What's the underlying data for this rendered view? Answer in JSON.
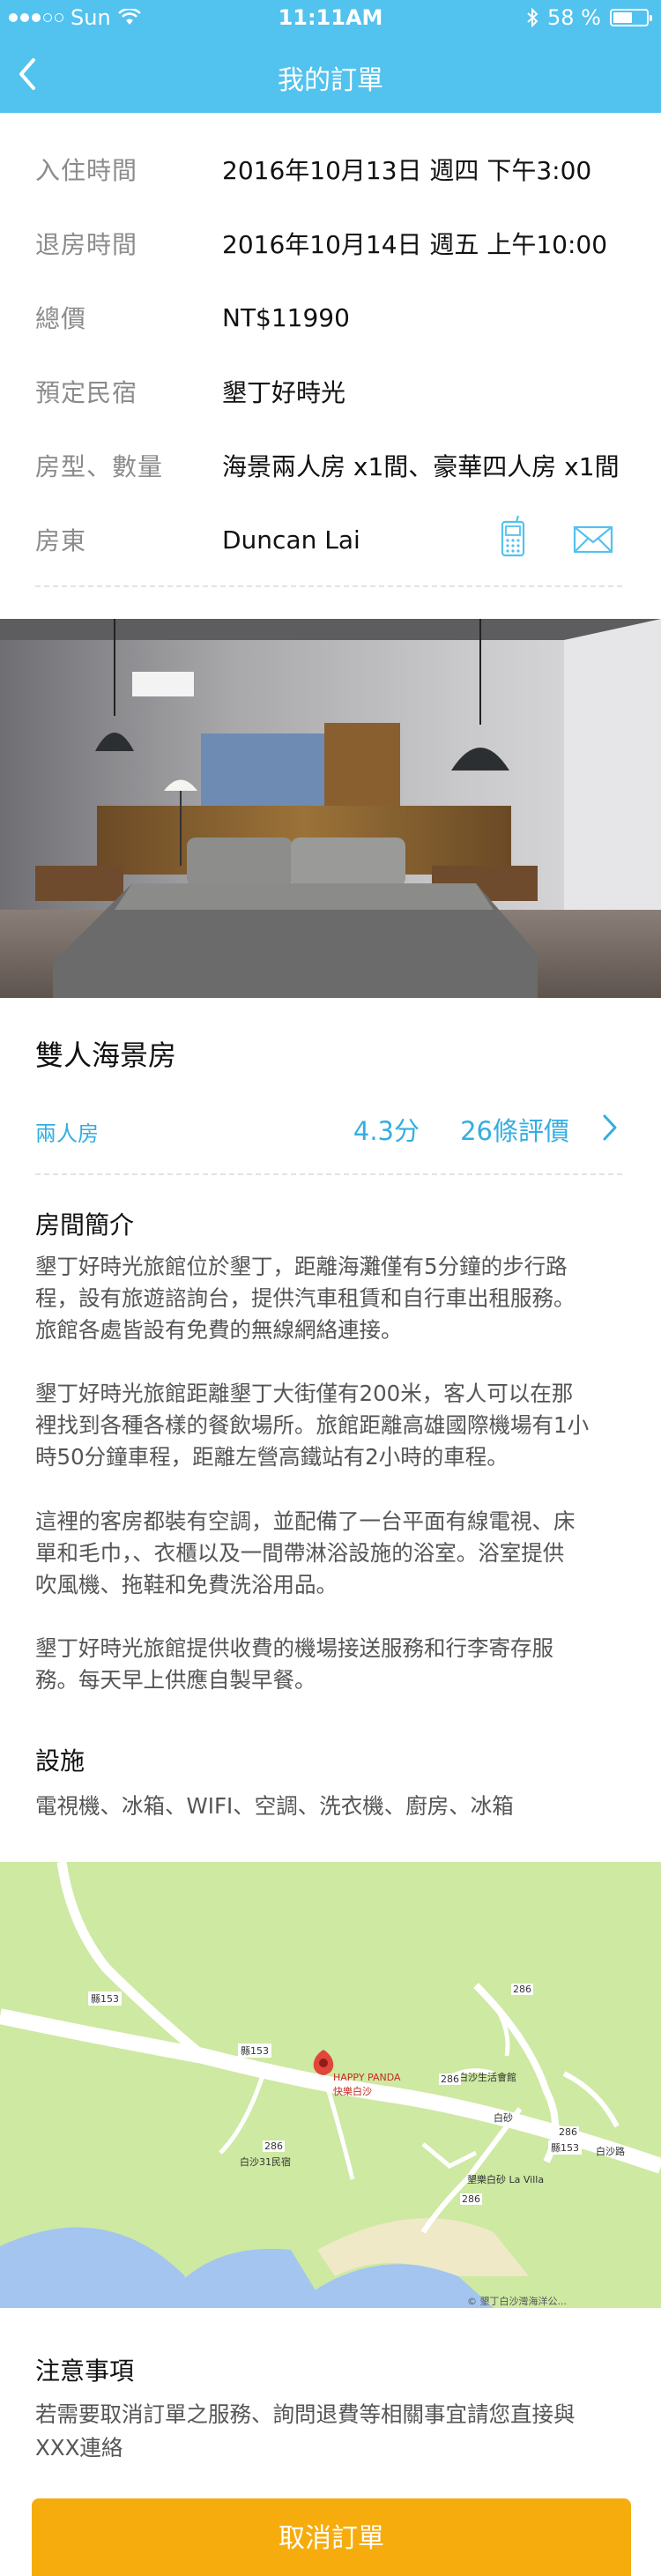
{
  "status": {
    "carrier": "Sun",
    "time": "11:11AM",
    "battery": "58 %",
    "battery_level": 0.58
  },
  "nav": {
    "title": "我的訂單",
    "back_icon": "chevron-left-icon"
  },
  "order": {
    "checkin": {
      "label": "入住時間",
      "value": "2016年10月13日 週四 下午3:00"
    },
    "checkout": {
      "label": "退房時間",
      "value": "2016年10月14日 週五 上午10:00"
    },
    "total": {
      "label": "總價",
      "value": "NT$11990"
    },
    "bnb": {
      "label": "預定民宿",
      "value": "墾丁好時光"
    },
    "rooms": {
      "label": "房型、數量",
      "value": "海景兩人房 x1間、豪華四人房 x1間"
    },
    "host": {
      "label": "房東",
      "value": "Duncan Lai",
      "phone_icon": "phone-icon",
      "mail_icon": "mail-icon"
    }
  },
  "room": {
    "name": "雙人海景房",
    "type": "兩人房",
    "rating": "4.3分",
    "reviews": "26條評價",
    "rating_value": 4.3,
    "review_count": 26
  },
  "intro": {
    "title": "房間簡介",
    "p1_l1": "墾丁好時光旅館位於墾丁，距離海灘僅有5分鐘的步行路",
    "p1_l2": "程，設有旅遊諮詢台，提供汽車租賃和自行車出租服務。",
    "p1_l3": "旅館各處皆設有免費的無線網絡連接。",
    "p2_l1": "墾丁好時光旅館距離墾丁大街僅有200米，客人可以在那",
    "p2_l2": "裡找到各種各樣的餐飲場所。旅館距離高雄國際機場有1小",
    "p2_l3": "時50分鐘車程，距離左營高鐵站有2小時的車程。",
    "p3_l1": "這裡的客房都裝有空調，並配備了一台平面有線電視、床",
    "p3_l2": "單和毛巾，、衣櫃以及一間帶淋浴設施的浴室。浴室提供",
    "p3_l3": "吹風機、拖鞋和免費洗浴用品。",
    "p4_l1": "墾丁好時光旅館提供收費的機場接送服務和行李寄存服",
    "p4_l2": "務。每天早上供應自製早餐。"
  },
  "facilities": {
    "title": "設施",
    "list": "電視機、冰箱、WIFI、空調、洗衣機、廚房、冰箱"
  },
  "map": {
    "pin_en": "HAPPY PANDA",
    "pin_zh": "快樂白沙",
    "place1": "白沙生活會館",
    "place2": "白砂",
    "place3": "白沙31民宿",
    "place4": "墾樂白砂 La Villa",
    "road1": "縣153",
    "road2": "縣153",
    "road3": "縣153",
    "road4": "白沙路",
    "road5": "286",
    "road6": "286",
    "road7": "286",
    "road8": "286",
    "road9": "286",
    "attribution": "© 墾丁白沙灣海洋公..."
  },
  "notice": {
    "title": "注意事項",
    "l1": "若需要取消訂單之服務、詢問退費等相關事宜請您直接與",
    "l2": "XXX連絡"
  },
  "actions": {
    "cancel": "取消訂單"
  },
  "colors": {
    "header": "#52c2ee",
    "accent": "#33aee0",
    "cancel": "#f6ac0c"
  }
}
